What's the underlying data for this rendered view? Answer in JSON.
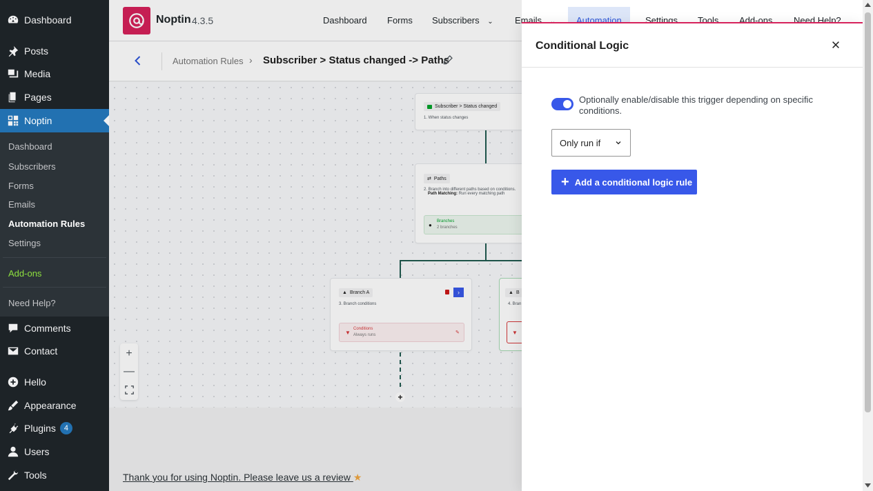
{
  "sidebar": {
    "items": [
      {
        "label": "Dashboard",
        "icon": "dashboard-icon"
      },
      {
        "label": "Posts",
        "icon": "pin-icon"
      },
      {
        "label": "Media",
        "icon": "media-icon"
      },
      {
        "label": "Pages",
        "icon": "pages-icon"
      },
      {
        "label": "Noptin",
        "icon": "noptin-grid-icon",
        "active": true
      },
      {
        "label": "Comments",
        "icon": "comment-icon"
      },
      {
        "label": "Contact",
        "icon": "mail-icon"
      },
      {
        "label": "Hello",
        "icon": "plus-circle-icon"
      },
      {
        "label": "Appearance",
        "icon": "brush-icon"
      },
      {
        "label": "Plugins",
        "icon": "plugin-icon",
        "badge": "4"
      },
      {
        "label": "Users",
        "icon": "user-icon"
      },
      {
        "label": "Tools",
        "icon": "wrench-icon"
      }
    ],
    "submenu": [
      "Dashboard",
      "Subscribers",
      "Forms",
      "Emails",
      "Automation Rules",
      "Settings",
      "Add-ons",
      "Need Help?"
    ]
  },
  "header": {
    "brand": "Noptin",
    "version": "4.3.5",
    "nav": [
      "Dashboard",
      "Forms",
      "Subscribers",
      "Emails",
      "Automation",
      "Settings",
      "Tools",
      "Add-ons",
      "Need Help?"
    ]
  },
  "breadcrumb": {
    "root": "Automation Rules",
    "title": "Subscriber > Status changed -> Paths"
  },
  "canvas": {
    "trigger": {
      "title": "Subscriber > Status changed",
      "desc": "1. When status changes"
    },
    "paths": {
      "title": "Paths",
      "desc": "2. Branch into different paths based on conditions.",
      "matching_label": "Path Matching:",
      "matching_value": "Run every matching path",
      "branches_label": "Branches",
      "branches_count": "2 branches"
    },
    "branch_a": {
      "title": "Branch A",
      "desc": "3. Branch conditions",
      "cond_label": "Conditions",
      "cond_value": "Always runs"
    },
    "branch_b": {
      "title": "B",
      "desc": "4. Bran"
    }
  },
  "footer": {
    "note": "Thank you for using Noptin. Please leave us a review"
  },
  "panel": {
    "title": "Conditional Logic",
    "toggle_label": "Optionally enable/disable this trigger depending on specific conditions.",
    "select_value": "Only run if",
    "add_button": "Add a conditional logic rule"
  },
  "colors": {
    "brand": "#d6215b",
    "accent": "#3858e9",
    "wp_active": "#2271b1",
    "sidebar_bg": "#1d2327"
  }
}
